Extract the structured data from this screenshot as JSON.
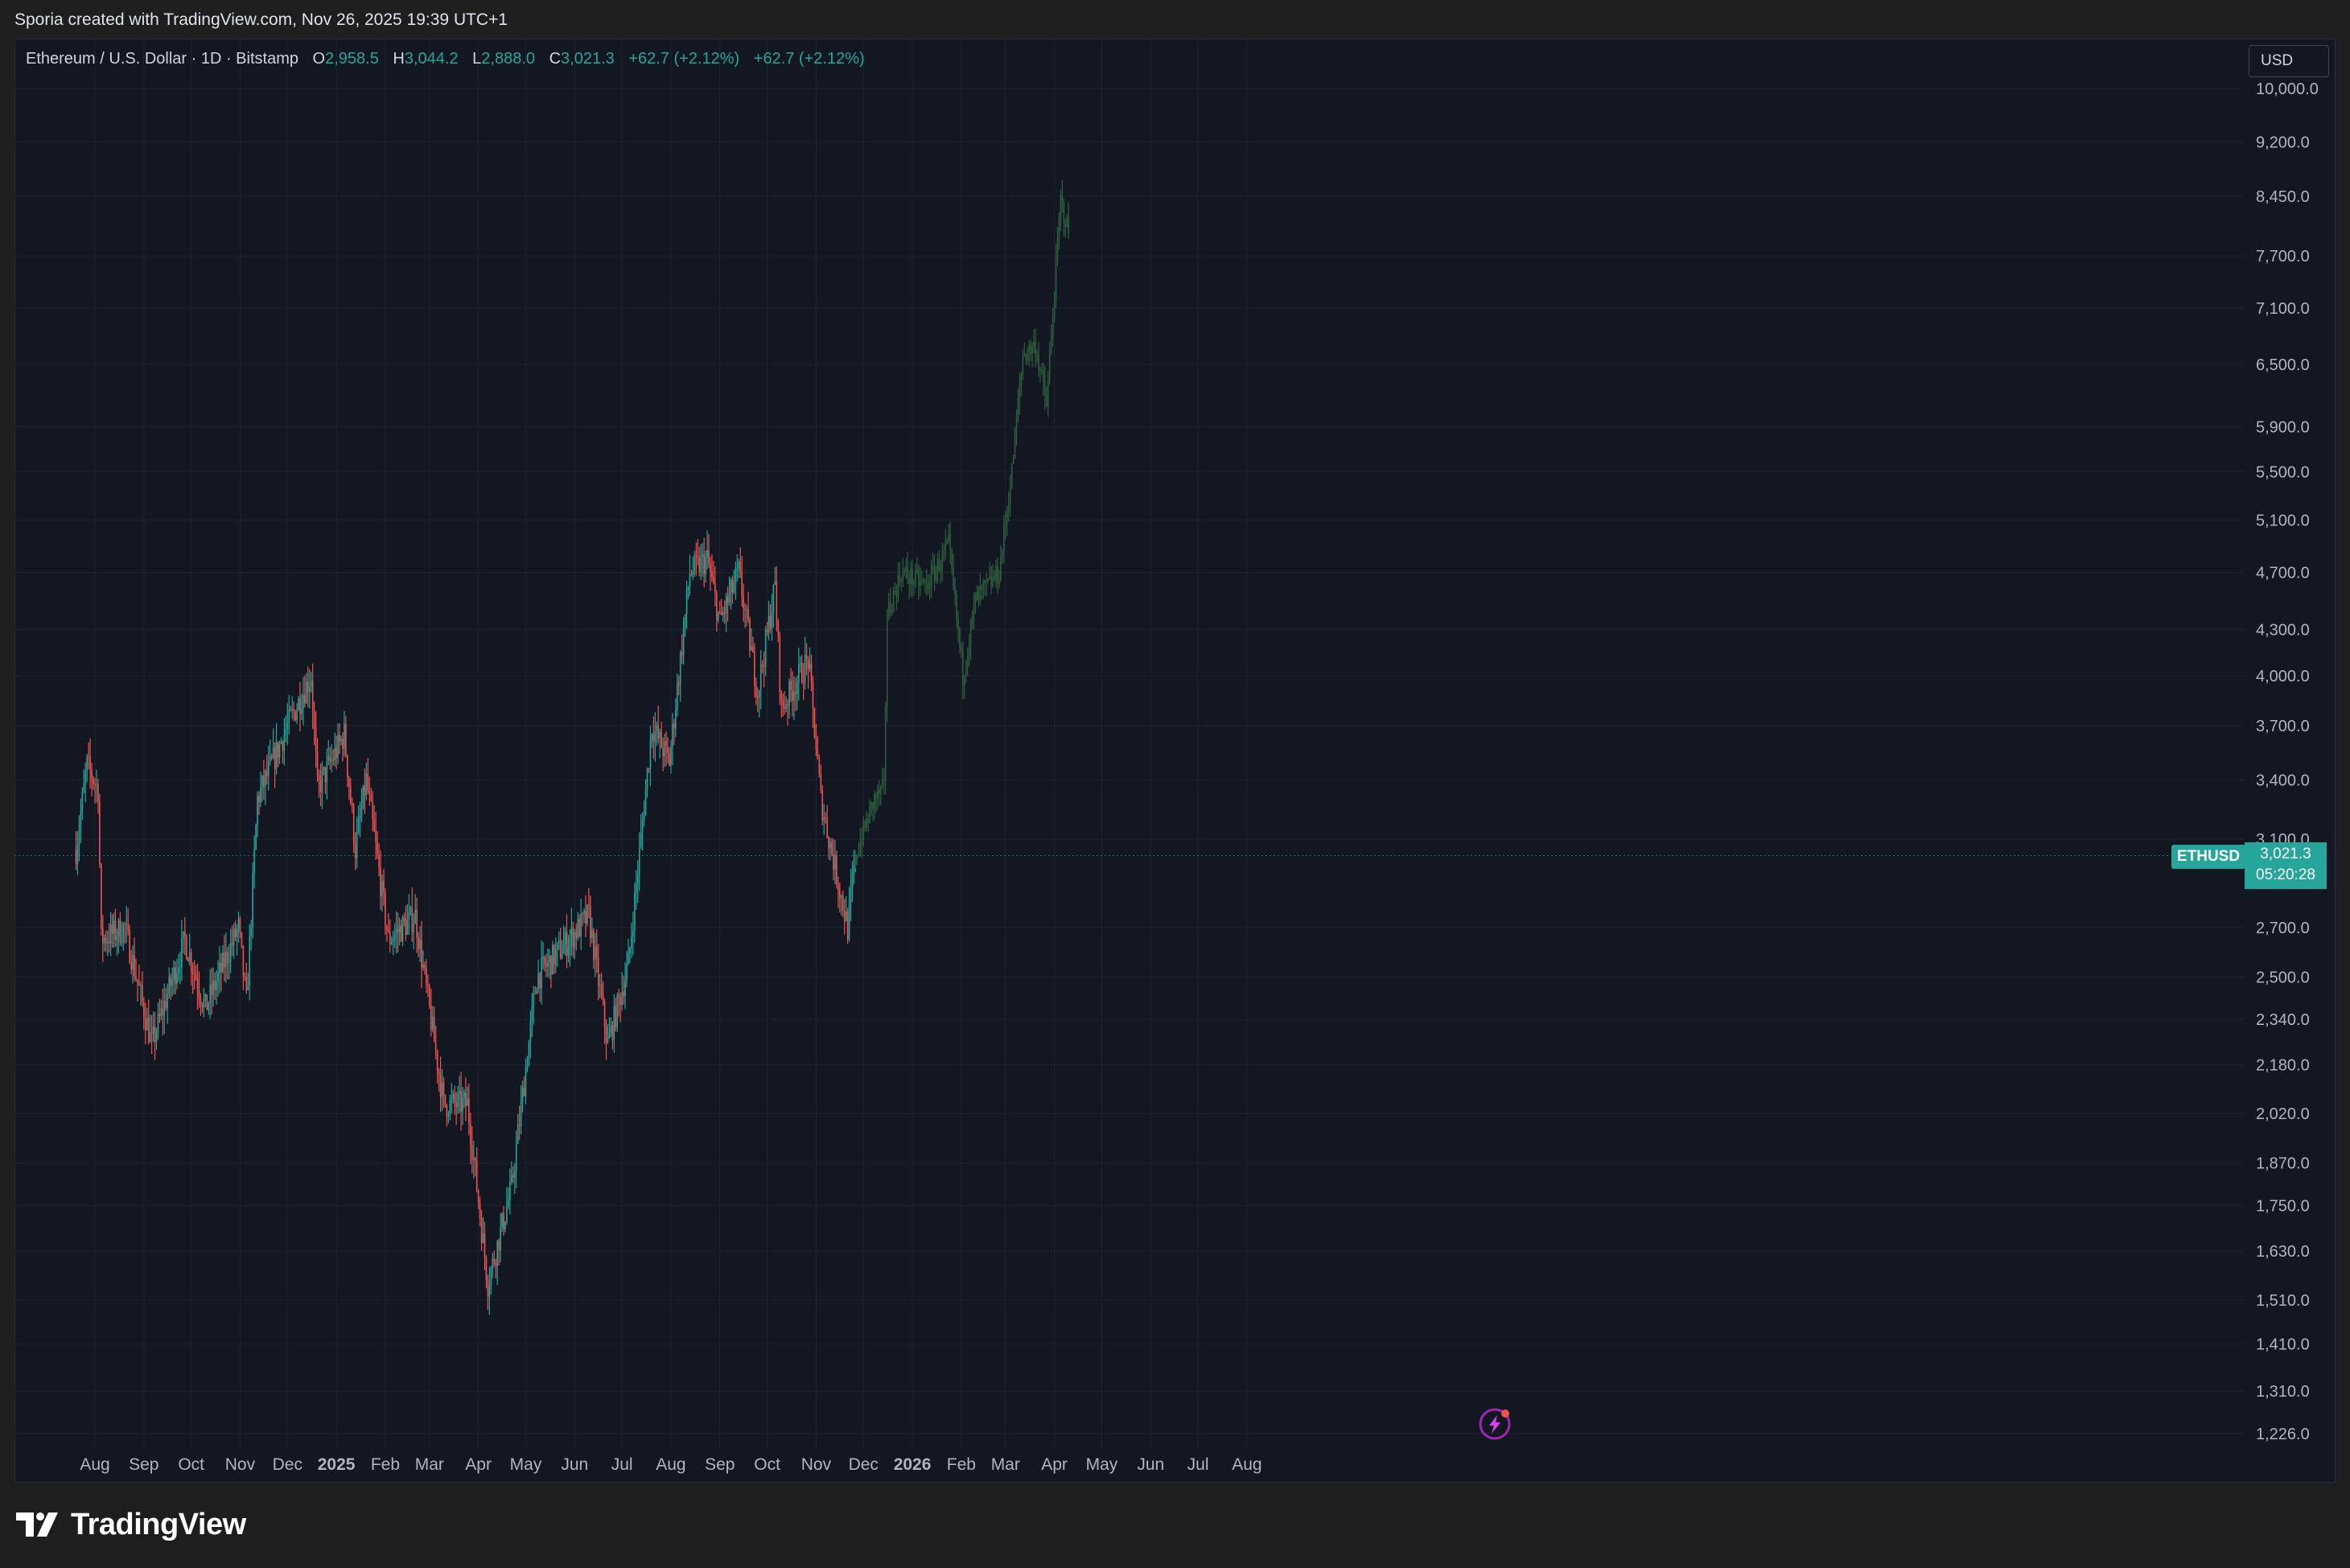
{
  "header": {
    "caption": "Sporia created with TradingView.com, Nov 26, 2025 19:39 UTC+1"
  },
  "legend": {
    "symbol": "Ethereum / U.S. Dollar · 1D · Bitstamp",
    "open_label": "O",
    "open": "2,958.5",
    "high_label": "H",
    "high": "3,044.2",
    "low_label": "L",
    "low": "2,888.0",
    "close_label": "C",
    "close": "3,021.3",
    "change1": "+62.7 (+2.12%)",
    "change2": "+62.7 (+2.12%)"
  },
  "currency_button": "USD",
  "last_price": {
    "ticker": "ETHUSD",
    "price": "3,021.3",
    "countdown": "05:20:28"
  },
  "branding": {
    "logo_text": "TradingView"
  },
  "icons": {
    "logo": "tradingview-logo-icon",
    "marker": "lightning-event-icon"
  },
  "colors": {
    "up": "#26a69a",
    "down": "#ef5350",
    "projection": "#2f5e3d",
    "background": "#131722"
  },
  "chart_data": {
    "type": "candlestick",
    "series": [
      {
        "name": "ETHUSD",
        "interval": "1D",
        "exchange": "Bitstamp"
      }
    ],
    "y_axis": {
      "scale": "log",
      "range": [
        1226,
        10000
      ],
      "ticks": [
        "10,000.0",
        "9,200.0",
        "8,450.0",
        "7,700.0",
        "7,100.0",
        "6,500.0",
        "5,900.0",
        "5,500.0",
        "5,100.0",
        "4,700.0",
        "4,300.0",
        "4,000.0",
        "3,700.0",
        "3,400.0",
        "3,100.0",
        "2,700.0",
        "2,500.0",
        "2,340.0",
        "2,180.0",
        "2,020.0",
        "1,870.0",
        "1,750.0",
        "1,630.0",
        "1,510.0",
        "1,410.0",
        "1,310.0",
        "1,226.0"
      ]
    },
    "x_axis": {
      "ticks": [
        "Aug",
        "Sep",
        "Oct",
        "Nov",
        "Dec",
        "2025",
        "Feb",
        "Mar",
        "Apr",
        "May",
        "Jun",
        "Jul",
        "Aug",
        "Sep",
        "Oct",
        "Nov",
        "Dec",
        "2026",
        "Feb",
        "Mar",
        "Apr",
        "May",
        "Jun",
        "Jul",
        "Aug"
      ]
    },
    "price_path": [
      [
        "2024-07-20",
        3050
      ],
      [
        "2024-07-27",
        3480
      ],
      [
        "2024-08-03",
        3350
      ],
      [
        "2024-08-05",
        2650
      ],
      [
        "2024-08-20",
        2700
      ],
      [
        "2024-09-06",
        2250
      ],
      [
        "2024-09-27",
        2650
      ],
      [
        "2024-10-10",
        2380
      ],
      [
        "2024-10-31",
        2700
      ],
      [
        "2024-11-05",
        2400
      ],
      [
        "2024-11-12",
        3300
      ],
      [
        "2024-12-01",
        3700
      ],
      [
        "2024-12-16",
        4000
      ],
      [
        "2024-12-20",
        3350
      ],
      [
        "2025-01-06",
        3650
      ],
      [
        "2025-01-13",
        3050
      ],
      [
        "2025-01-20",
        3400
      ],
      [
        "2025-02-03",
        2650
      ],
      [
        "2025-02-20",
        2750
      ],
      [
        "2025-03-10",
        2050
      ],
      [
        "2025-03-25",
        2050
      ],
      [
        "2025-04-07",
        1550
      ],
      [
        "2025-04-22",
        1800
      ],
      [
        "2025-05-08",
        2500
      ],
      [
        "2025-06-10",
        2750
      ],
      [
        "2025-06-22",
        2250
      ],
      [
        "2025-07-05",
        2550
      ],
      [
        "2025-07-20",
        3700
      ],
      [
        "2025-07-31",
        3500
      ],
      [
        "2025-08-13",
        4700
      ],
      [
        "2025-08-24",
        4800
      ],
      [
        "2025-09-01",
        4350
      ],
      [
        "2025-09-13",
        4700
      ],
      [
        "2025-09-25",
        3900
      ],
      [
        "2025-10-06",
        4600
      ],
      [
        "2025-10-10",
        3800
      ],
      [
        "2025-10-27",
        4100
      ],
      [
        "2025-11-04",
        3300
      ],
      [
        "2025-11-21",
        2700
      ],
      [
        "2025-11-26",
        3021.3
      ]
    ],
    "projection_path": [
      [
        "2025-11-26",
        3021.3
      ],
      [
        "2025-12-08",
        3300
      ],
      [
        "2025-12-14",
        3350
      ],
      [
        "2025-12-16",
        4400
      ],
      [
        "2025-12-25",
        4700
      ],
      [
        "2026-01-10",
        4600
      ],
      [
        "2026-01-24",
        4900
      ],
      [
        "2026-02-02",
        4000
      ],
      [
        "2026-02-10",
        4500
      ],
      [
        "2026-02-25",
        4700
      ],
      [
        "2026-03-05",
        5500
      ],
      [
        "2026-03-12",
        6600
      ],
      [
        "2026-03-20",
        6700
      ],
      [
        "2026-03-27",
        6100
      ],
      [
        "2026-04-05",
        8400
      ],
      [
        "2026-04-10",
        8000
      ]
    ],
    "last_close": 3021.3,
    "grid": true,
    "legend_position": "top-left"
  }
}
